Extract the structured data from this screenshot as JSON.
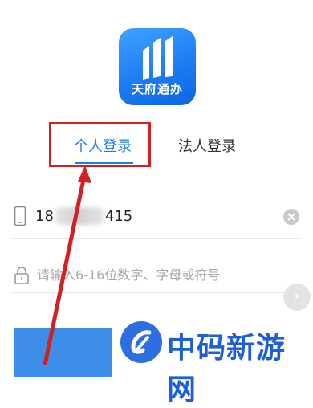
{
  "app": {
    "logo_text": "天府通办",
    "accent_color": "#1f7fe0"
  },
  "tabs": [
    {
      "label": "个人登录",
      "active": true
    },
    {
      "label": "法人登录",
      "active": false
    }
  ],
  "phone": {
    "prefix": "18",
    "suffix": "415",
    "icon": "phone-icon",
    "clear_icon": "clear-icon"
  },
  "password": {
    "placeholder": "请输入6-16位数字、字母或符号",
    "icon": "lock-icon"
  },
  "watermark": {
    "text": "中码新游网"
  }
}
